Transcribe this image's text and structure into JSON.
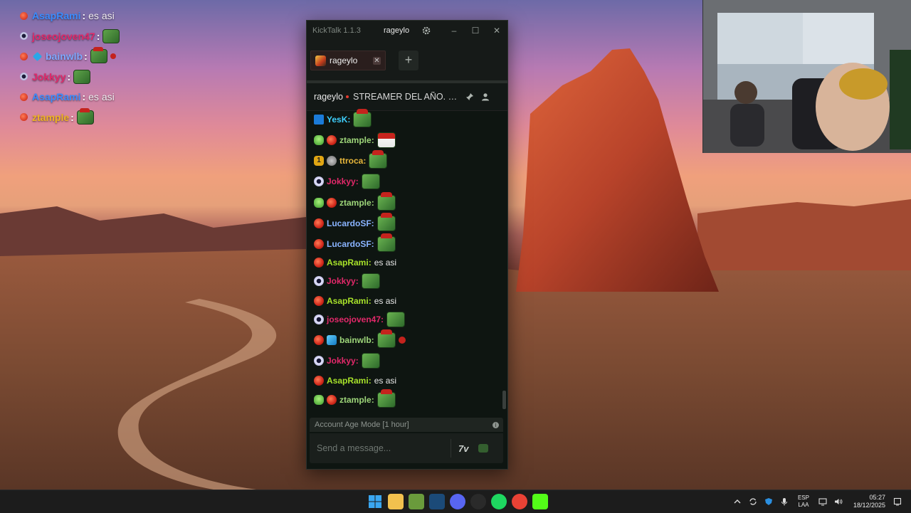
{
  "overlay_chat": [
    {
      "badges": [
        "red"
      ],
      "name": "AsapRami",
      "name_color": "#3b8cff",
      "message": "es asi",
      "emotes": []
    },
    {
      "badges": [
        "eye"
      ],
      "name": "joseojoven47",
      "name_color": "#e3286a",
      "message": "",
      "emotes": [
        "pepe"
      ]
    },
    {
      "badges": [
        "red",
        "cube"
      ],
      "name": "bainwlb",
      "name_color": "#7fa8ff",
      "message": "",
      "emotes": [
        "pepe-hat",
        "mini"
      ]
    },
    {
      "badges": [
        "eye"
      ],
      "name": "Jokkyy",
      "name_color": "#e3286a",
      "message": "",
      "emotes": [
        "pepe"
      ]
    },
    {
      "badges": [
        "red"
      ],
      "name": "AsapRami",
      "name_color": "#3b8cff",
      "message": "es asi",
      "emotes": []
    },
    {
      "badges": [
        "red"
      ],
      "name": "ztample",
      "name_color": "#f0b323",
      "message": "",
      "emotes": [
        "pepe-hat"
      ]
    }
  ],
  "window": {
    "app_title": "KickTalk 1.1.3",
    "titlebar_user": "rageylo",
    "controls": {
      "minimize": "–",
      "maximize": "☐",
      "close": "✕"
    }
  },
  "tabs": [
    {
      "label": "rageylo",
      "close": "✕"
    }
  ],
  "add_tab": "+",
  "channel": {
    "name": "rageylo",
    "title": "STREAMER DEL AÑO. GANADOR PREMIOS ESLAND"
  },
  "messages": [
    {
      "badges": [
        "kick"
      ],
      "name": "YesK",
      "name_color": "#3fd1ff",
      "text": "",
      "emotes": [
        "pepe-hat"
      ]
    },
    {
      "badges": [
        "green",
        "red"
      ],
      "name": "ztample",
      "name_color": "#9ed67a",
      "text": "",
      "emotes": [
        "santa"
      ]
    },
    {
      "badges": [
        "gold",
        "gray"
      ],
      "name": "ttroca",
      "name_color": "#e4b43a",
      "text": "",
      "emotes": [
        "pepe-hat"
      ]
    },
    {
      "badges": [
        "eye"
      ],
      "name": "Jokkyy",
      "name_color": "#e3286a",
      "text": "",
      "emotes": [
        "pepe"
      ]
    },
    {
      "badges": [
        "green",
        "red"
      ],
      "name": "ztample",
      "name_color": "#9ed67a",
      "text": "",
      "emotes": [
        "pepe-hat"
      ]
    },
    {
      "badges": [
        "red"
      ],
      "name": "LucardoSF",
      "name_color": "#8ab4ff",
      "text": "",
      "emotes": [
        "pepe-hat"
      ]
    },
    {
      "badges": [
        "red"
      ],
      "name": "LucardoSF",
      "name_color": "#8ab4ff",
      "text": "",
      "emotes": [
        "pepe-hat"
      ]
    },
    {
      "badges": [
        "red"
      ],
      "name": "AsapRami",
      "name_color": "#a8e22a",
      "text": "es asi",
      "emotes": []
    },
    {
      "badges": [
        "eye"
      ],
      "name": "Jokkyy",
      "name_color": "#e3286a",
      "text": "",
      "emotes": [
        "pepe"
      ]
    },
    {
      "badges": [
        "red"
      ],
      "name": "AsapRami",
      "name_color": "#a8e22a",
      "text": "es asi",
      "emotes": []
    },
    {
      "badges": [
        "eye"
      ],
      "name": "joseojoven47",
      "name_color": "#e3286a",
      "text": "",
      "emotes": [
        "pepe"
      ]
    },
    {
      "badges": [
        "red",
        "cube"
      ],
      "name": "bainwlb",
      "name_color": "#9ed67a",
      "text": "",
      "emotes": [
        "pepe-hat",
        "mini"
      ]
    },
    {
      "badges": [
        "eye"
      ],
      "name": "Jokkyy",
      "name_color": "#e3286a",
      "text": "",
      "emotes": [
        "pepe"
      ]
    },
    {
      "badges": [
        "red"
      ],
      "name": "AsapRami",
      "name_color": "#a8e22a",
      "text": "es asi",
      "emotes": []
    },
    {
      "badges": [
        "green",
        "red"
      ],
      "name": "ztample",
      "name_color": "#9ed67a",
      "text": "",
      "emotes": [
        "pepe-hat"
      ]
    }
  ],
  "notice": {
    "text": "Account Age Mode [1 hour]",
    "icon": "i"
  },
  "composer": {
    "placeholder": "Send a message..."
  },
  "taskbar": {
    "apps": [
      {
        "name": "windows-start",
        "color": "#3aa6f0"
      },
      {
        "name": "file-explorer",
        "color": "#f2c14e"
      },
      {
        "name": "minecraft",
        "color": "#6a9b3c"
      },
      {
        "name": "steam",
        "color": "#1b4a78"
      },
      {
        "name": "discord",
        "color": "#5865f2"
      },
      {
        "name": "obs",
        "color": "#2a2a2a"
      },
      {
        "name": "spotify",
        "color": "#1ed760"
      },
      {
        "name": "chrome",
        "color": "#e94235"
      },
      {
        "name": "kick",
        "color": "#53fc18"
      }
    ],
    "lang_top": "ESP",
    "lang_bottom": "LAA",
    "time": "05:27",
    "date": "18/12/2025"
  }
}
